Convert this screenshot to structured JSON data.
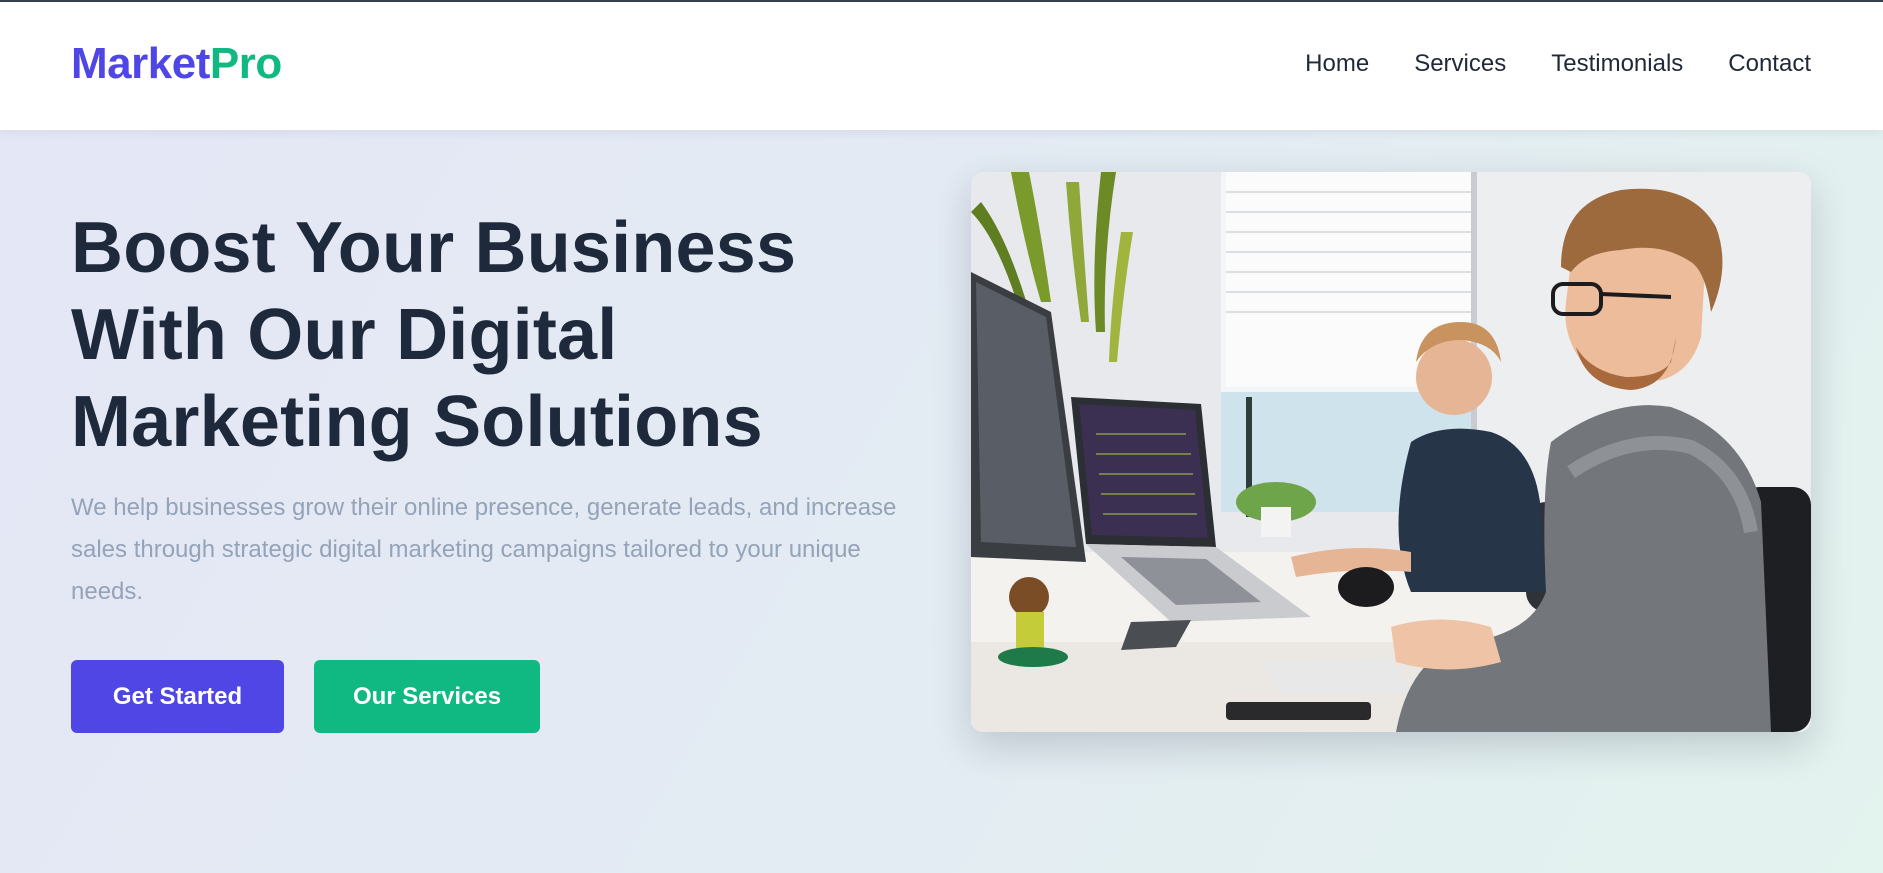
{
  "header": {
    "logo_part1": "Market",
    "logo_part2": "Pro",
    "nav": [
      "Home",
      "Services",
      "Testimonials",
      "Contact"
    ]
  },
  "hero": {
    "title": "Boost Your Business With Our Digital Marketing Solutions",
    "subtitle": "We help businesses grow their online presence, generate leads, and increase sales through strategic digital marketing campaigns tailored to your unique needs.",
    "primary_button": "Get Started",
    "secondary_button": "Our Services"
  },
  "colors": {
    "brand_primary": "#4f46e5",
    "brand_accent": "#10b981",
    "heading": "#1e293b",
    "muted_text": "#94a3b8"
  }
}
